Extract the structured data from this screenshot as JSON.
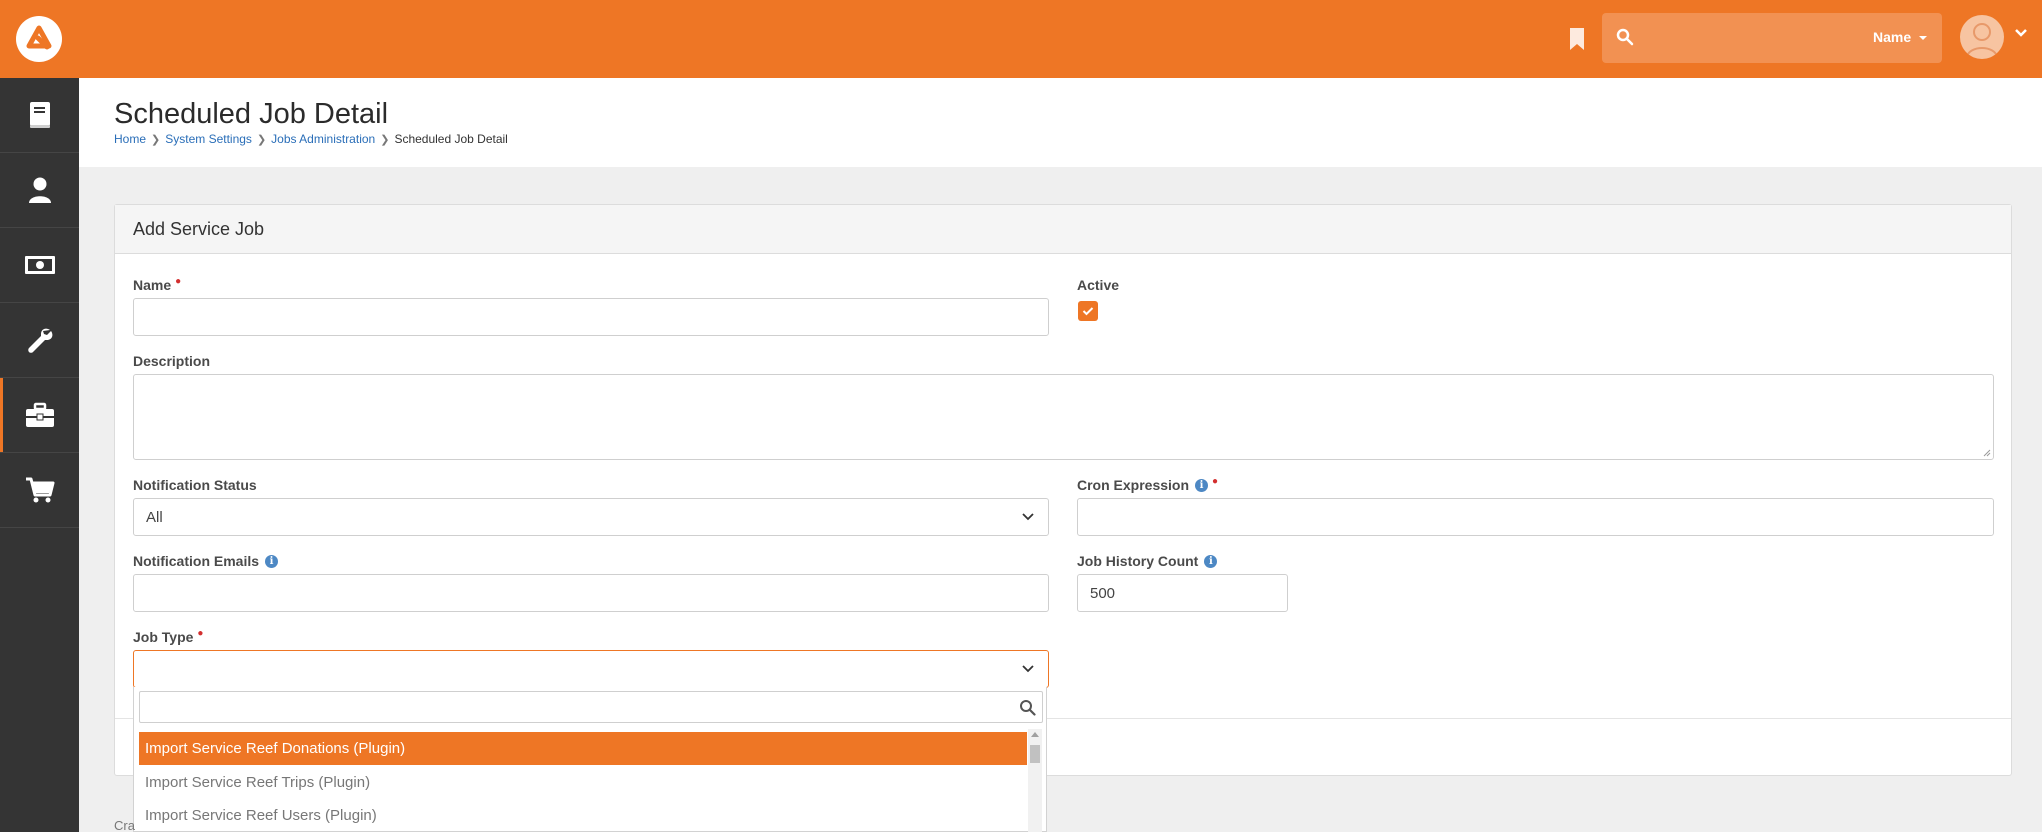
{
  "header": {
    "search_placeholder": "",
    "search_scope": "Name"
  },
  "page": {
    "title": "Scheduled Job Detail",
    "breadcrumb": [
      "Home",
      "System Settings",
      "Jobs Administration",
      "Scheduled Job Detail"
    ]
  },
  "form": {
    "panel_title": "Add Service Job",
    "name_label": "Name",
    "name_value": "",
    "active_label": "Active",
    "active_checked": true,
    "description_label": "Description",
    "notification_status_label": "Notification Status",
    "notification_status_value": "All",
    "cron_label": "Cron Expression",
    "cron_value": "",
    "notification_emails_label": "Notification Emails",
    "notification_emails_value": "",
    "job_history_label": "Job History Count",
    "job_history_value": "500",
    "job_type_label": "Job Type",
    "job_type_value": ""
  },
  "dropdown": {
    "search_value": "",
    "items": [
      {
        "label": "Import Service Reef Donations (Plugin)",
        "selected": true
      },
      {
        "label": "Import Service Reef Trips (Plugin)",
        "selected": false
      },
      {
        "label": "Import Service Reef Users (Plugin)",
        "selected": false
      }
    ]
  },
  "footer": {
    "partial_text": "Cra"
  },
  "colors": {
    "brand": "#ee7625",
    "sidebar": "#343434",
    "link": "#2a6eb8",
    "required": "#d32f2f"
  }
}
